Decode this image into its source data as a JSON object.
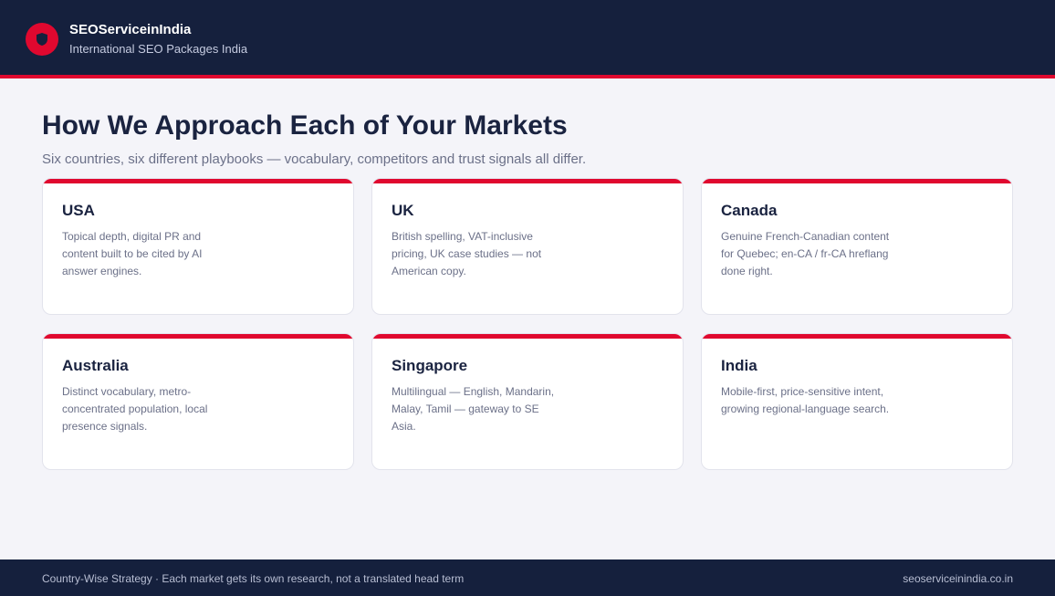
{
  "header": {
    "brand_name": "SEOServiceinIndia",
    "tagline": "International SEO Packages India",
    "logo_icon": "shield-icon"
  },
  "main": {
    "title": "How We Approach Each of Your Markets",
    "subtitle": "Six countries, six different playbooks — vocabulary, competitors and trust signals all differ.",
    "cards": [
      {
        "title": "USA",
        "body": "Topical depth, digital PR and content built to be cited by AI answer engines."
      },
      {
        "title": "UK",
        "body": "British spelling, VAT-inclusive pricing, UK case studies — not American copy."
      },
      {
        "title": "Canada",
        "body": "Genuine French-Canadian content for Quebec; en-CA / fr-CA hreflang done right."
      },
      {
        "title": "Australia",
        "body": "Distinct vocabulary, metro-concentrated population, local presence signals."
      },
      {
        "title": "Singapore",
        "body": "Multilingual — English, Mandarin, Malay, Tamil — gateway to SE Asia."
      },
      {
        "title": "India",
        "body": "Mobile-first, price-sensitive intent, growing regional-language search."
      }
    ]
  },
  "footer": {
    "left": "Country-Wise Strategy · Each market gets its own research, not a translated head term",
    "right": "seoserviceinindia.co.in"
  },
  "colors": {
    "navy": "#15203d",
    "accent": "#e0082f",
    "background": "#f4f4f9"
  }
}
